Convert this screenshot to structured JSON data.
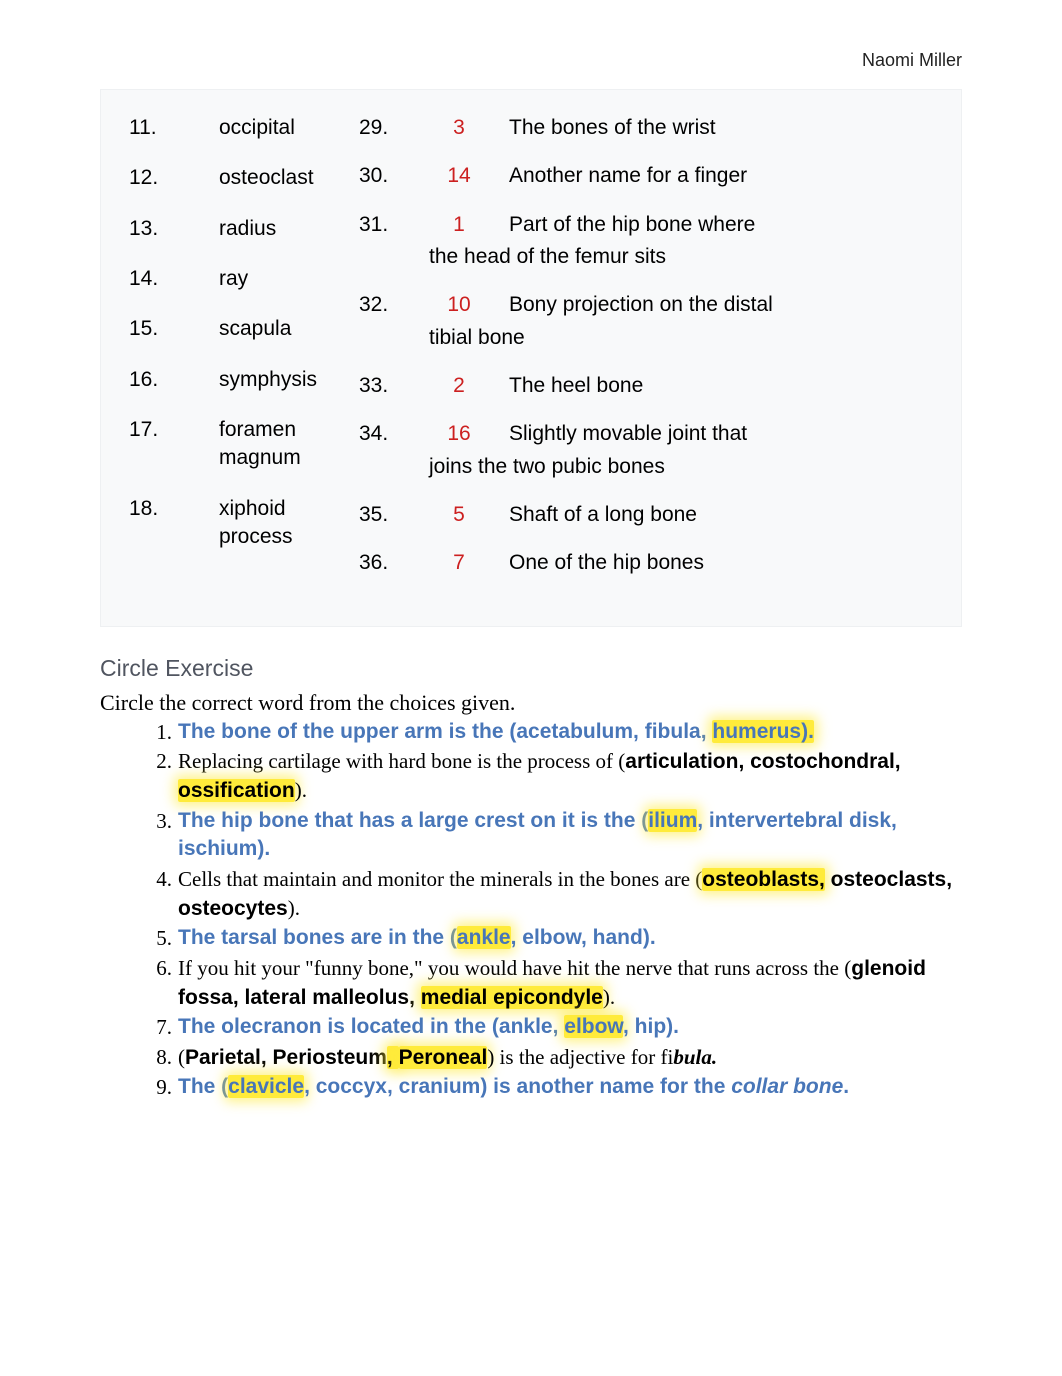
{
  "author": "Naomi Miller",
  "left_col": [
    {
      "num": "11.",
      "txt": "occipital"
    },
    {
      "num": "12.",
      "txt": "osteoclast"
    },
    {
      "num": "13.",
      "txt": "radius"
    },
    {
      "num": "14.",
      "txt": "ray"
    },
    {
      "num": "15.",
      "txt": "scapula"
    },
    {
      "num": "16.",
      "txt": "symphysis"
    },
    {
      "num": "17.",
      "txt": "foramen magnum"
    },
    {
      "num": "18.",
      "txt": "xiphoid process"
    }
  ],
  "right_col": [
    {
      "num": "29.",
      "ans": "3",
      "desc": "The bones of the wrist"
    },
    {
      "num": "30.",
      "ans": "14",
      "desc": "Another name for a finger"
    },
    {
      "num": "31.",
      "ans": "1",
      "desc": "Part of the hip bone where",
      "cont": "the head of the femur sits"
    },
    {
      "num": "32.",
      "ans": "10",
      "desc": "Bony projection on the distal",
      "cont": "tibial bone"
    },
    {
      "num": "33.",
      "ans": "2",
      "desc": "The heel bone"
    },
    {
      "num": "34.",
      "ans": "16",
      "desc": "Slightly movable joint that",
      "cont": "joins the two pubic bones"
    },
    {
      "num": "35.",
      "ans": "5",
      "desc": "Shaft of a long bone"
    },
    {
      "num": "36.",
      "ans": "7",
      "desc": "One of the hip bones"
    }
  ],
  "section_title": "Circle Exercise",
  "instruction": "Circle the correct word from the choices given.",
  "circle": [
    {
      "n": "1.",
      "type": "blue",
      "parts": [
        {
          "t": "The bone of the upper arm is the (acetabulum, fibula, "
        },
        {
          "t": "humerus).",
          "hl": true
        }
      ]
    },
    {
      "n": "2.",
      "type": "serif",
      "parts": [
        {
          "t": "Replacing cartilage with hard bone is the process of ("
        },
        {
          "t": "articulation, costochondral, ",
          "bold": true
        },
        {
          "t": "ossification",
          "bold": true,
          "hl": true
        },
        {
          "t": ")."
        }
      ]
    },
    {
      "n": "3.",
      "type": "blue",
      "parts": [
        {
          "t": "The hip bone that has a large crest on it is the ("
        },
        {
          "t": "ilium",
          "hl": true
        },
        {
          "t": ", intervertebral disk, ischium)."
        }
      ]
    },
    {
      "n": "4.",
      "type": "serif",
      "parts": [
        {
          "t": "Cells that maintain and monitor the minerals in the bones are ("
        },
        {
          "t": "osteoblasts,",
          "bold": true,
          "hl": true
        },
        {
          "t": " osteoclasts, osteocytes",
          "bold": true
        },
        {
          "t": ")."
        }
      ]
    },
    {
      "n": "5.",
      "type": "blue",
      "parts": [
        {
          "t": "The tarsal bones are in the ("
        },
        {
          "t": "ankle",
          "hl": true
        },
        {
          "t": ", elbow, hand)."
        }
      ]
    },
    {
      "n": "6.",
      "type": "serif",
      "parts": [
        {
          "t": "If you hit your \"funny bone,\" you would have hit the nerve that runs across the ("
        },
        {
          "t": "glenoid fossa, lateral malleolus, ",
          "bold": true
        },
        {
          "t": "medial epicondyle",
          "bold": true,
          "hl": true
        },
        {
          "t": ")."
        }
      ]
    },
    {
      "n": "7.",
      "type": "blue",
      "parts": [
        {
          "t": "The olecranon is located in the (ankle, "
        },
        {
          "t": "elbow",
          "hl": true
        },
        {
          "t": ", hip)."
        }
      ]
    },
    {
      "n": "8.",
      "type": "serif",
      "parts": [
        {
          "t": "("
        },
        {
          "t": "Parietal, Periosteum",
          "bold": true
        },
        {
          "t": ", ",
          "bold": true,
          "hl": true
        },
        {
          "t": "Peroneal",
          "bold": true,
          "hl": true
        },
        {
          "t": ") is the adjective for fi"
        },
        {
          "t": "bula.",
          "ital": true
        }
      ]
    },
    {
      "n": "9.",
      "type": "blue",
      "parts": [
        {
          "t": "The ("
        },
        {
          "t": "clavicle",
          "hl": true
        },
        {
          "t": ", coccyx, cranium) is another name for the "
        },
        {
          "t": "collar bone",
          "ital": true
        },
        {
          "t": "."
        }
      ]
    }
  ]
}
